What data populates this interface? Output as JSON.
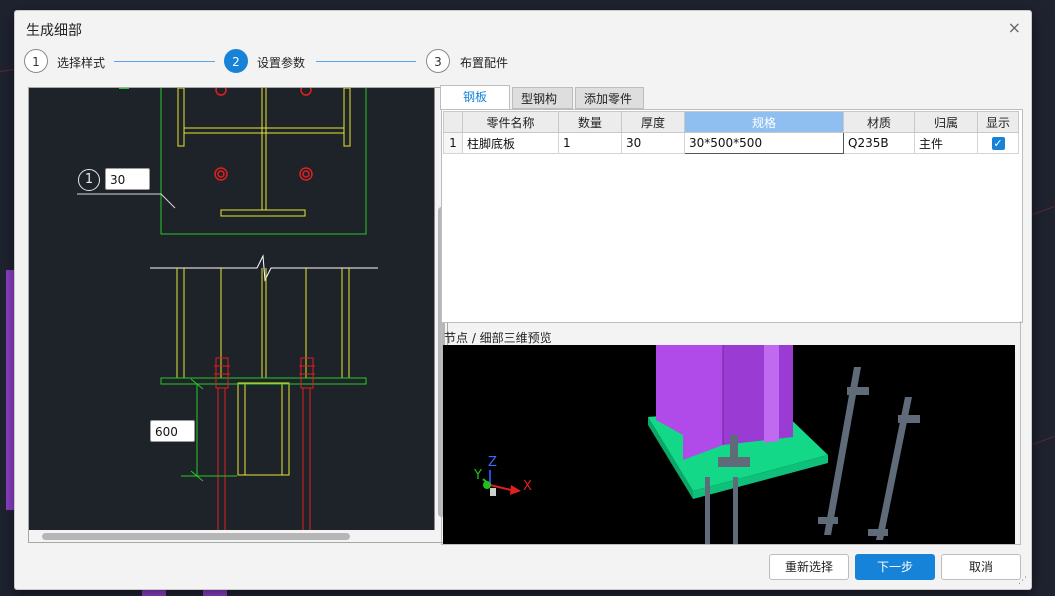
{
  "dialog": {
    "title": "生成细部",
    "close_icon": "×"
  },
  "steps": [
    {
      "number": "1",
      "label": "选择样式",
      "active": false
    },
    {
      "number": "2",
      "label": "设置参数",
      "active": true
    },
    {
      "number": "3",
      "label": "布置配件",
      "active": false
    }
  ],
  "drawing": {
    "marker_number": "1",
    "marker_value": "30",
    "dim_value": "600"
  },
  "tabs": [
    {
      "label": "钢板",
      "active": true
    },
    {
      "label": "型钢构件",
      "active": false
    },
    {
      "label": "添加零件",
      "active": false
    }
  ],
  "grid": {
    "columns": [
      "零件名称",
      "数量",
      "厚度",
      "规格",
      "材质",
      "归属",
      "显示"
    ],
    "selected_column": "规格",
    "rows": [
      {
        "index": "1",
        "name": "柱脚底板",
        "qty": "1",
        "thickness": "30",
        "spec": "30*500*500",
        "material": "Q235B",
        "owner": "主件",
        "show": true
      }
    ]
  },
  "preview": {
    "label": "节点 / 细部三维预览",
    "axis_x": "X",
    "axis_y": "Y",
    "axis_z": "Z"
  },
  "buttons": {
    "reselect": "重新选择",
    "next": "下一步",
    "cancel": "取消"
  },
  "colors": {
    "accent": "#1683d8",
    "cad_yellow": "#e6e632",
    "cad_green": "#28c828",
    "cad_red": "#e02020",
    "column_purple": "#b04ae8",
    "plate_green": "#12d888"
  }
}
